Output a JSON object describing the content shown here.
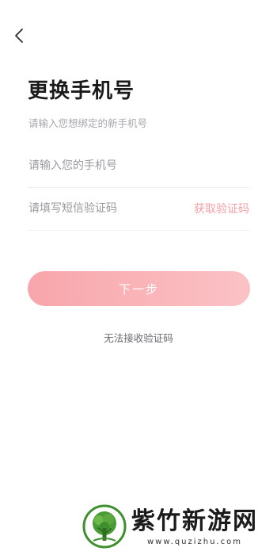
{
  "header": {
    "back_icon": "chevron-left-icon"
  },
  "main": {
    "title": "更换手机号",
    "subtitle": "请输入您想绑定的新手机号",
    "phone_field": {
      "value": "",
      "placeholder": "请输入您的手机号"
    },
    "code_field": {
      "value": "",
      "placeholder": "请填写短信验证码"
    },
    "get_code_label": "获取验证码",
    "next_button_label": "下一步",
    "cannot_receive_label": "无法接收验证码"
  },
  "watermark": {
    "name": "紫竹新游网",
    "url": "www.quzizhu.com",
    "logo_icon": "tree-logo-icon"
  },
  "colors": {
    "accent": "#f8a6ab",
    "accent_light": "#fbc2c5",
    "link": "#f6a0a6",
    "logo_green": "#3f8f2f"
  }
}
